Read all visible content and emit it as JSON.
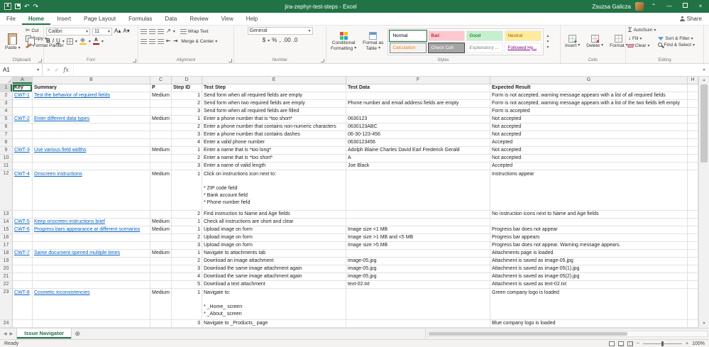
{
  "title_bar": {
    "title": "jira-zephyr-test-steps - Excel",
    "user_name": "Zsuzsa Galicza"
  },
  "ribbon_tabs": {
    "items": [
      {
        "label": "File",
        "active": false
      },
      {
        "label": "Home",
        "active": true
      },
      {
        "label": "Insert",
        "active": false
      },
      {
        "label": "Page Layout",
        "active": false
      },
      {
        "label": "Formulas",
        "active": false
      },
      {
        "label": "Data",
        "active": false
      },
      {
        "label": "Review",
        "active": false
      },
      {
        "label": "View",
        "active": false
      },
      {
        "label": "Help",
        "active": false
      }
    ],
    "share_label": "Share"
  },
  "ribbon": {
    "clipboard": {
      "group_label": "Clipboard",
      "paste_label": "Paste",
      "cut_label": "Cut",
      "copy_label": "Copy",
      "format_painter_label": "Format Painter"
    },
    "font": {
      "group_label": "Font",
      "font_name": "Calibri",
      "font_size": "11",
      "bold": "B",
      "italic": "I",
      "underline": "U"
    },
    "alignment": {
      "group_label": "Alignment",
      "wrap_text_label": "Wrap Text",
      "merge_center_label": "Merge & Center"
    },
    "number": {
      "group_label": "Number",
      "format_value": "General",
      "currency": "$",
      "percent": "%",
      "comma": ",",
      "increase_decimal": ".00",
      "decrease_decimal": ".0"
    },
    "styles": {
      "group_label": "Styles",
      "conditional_line1": "Conditional",
      "conditional_line2": "Formatting",
      "format_table_line1": "Format as",
      "format_table_line2": "Table",
      "cell_styles": [
        {
          "label": "Normal",
          "bg": "#ffffff",
          "fg": "#000000",
          "selected": true
        },
        {
          "label": "Bad",
          "bg": "#ffc7ce",
          "fg": "#9c0006"
        },
        {
          "label": "Good",
          "bg": "#c6efce",
          "fg": "#006100"
        },
        {
          "label": "Neutral",
          "bg": "#ffeb9c",
          "fg": "#9c6500"
        },
        {
          "label": "Calculation",
          "bg": "#f2f2f2",
          "fg": "#fa7d00",
          "border": "#7f7f7f"
        },
        {
          "label": "Check Cell",
          "bg": "#a5a5a5",
          "fg": "#ffffff",
          "border": "#3f3f3f"
        },
        {
          "label": "Explanatory ...",
          "bg": "#ffffff",
          "fg": "#7f7f7f",
          "italic": true
        },
        {
          "label": "Followed Hy...",
          "bg": "#ffffff",
          "fg": "#800080",
          "underline": true
        }
      ]
    },
    "cells": {
      "group_label": "Cells",
      "insert_label": "Insert",
      "delete_label": "Delete",
      "format_label": "Format"
    },
    "editing": {
      "group_label": "Editing",
      "autosum_label": "AutoSum",
      "fill_label": "Fill",
      "clear_label": "Clear",
      "sort_label": "Sort & Filter",
      "find_label": "Find & Select"
    }
  },
  "formula_bar": {
    "name_box": "A1",
    "formula": "",
    "fx_label": "fx"
  },
  "grid": {
    "col_headers": [
      "A",
      "B",
      "C",
      "D",
      "E",
      "F",
      "G",
      "H"
    ],
    "header_row": {
      "key": "Key",
      "summary": "Summary",
      "p": "P",
      "step_id": "Step ID",
      "test_step": "Test Step",
      "test_data": "Test Data",
      "expected": "Expected Result"
    },
    "rows": [
      {
        "n": 2,
        "key": "CWT-1",
        "summary": "Test the behavior of required fields",
        "p": "Medium",
        "step": "1",
        "text": "Send form when all required fields are empty",
        "data": "",
        "expected": "Form is not accepted, warning message appears with a list of all required fields"
      },
      {
        "n": 3,
        "key": "",
        "summary": "",
        "p": "",
        "step": "2",
        "text": "Send form when two required fields are empty",
        "data": "Phone number and email address fields are empty",
        "expected": "Form is not accepted, warning message appears with a list of the two fields left empty"
      },
      {
        "n": 4,
        "key": "",
        "summary": "",
        "p": "",
        "step": "3",
        "text": "Send form when all required fields are filled",
        "data": "",
        "expected": "Form is accepted"
      },
      {
        "n": 5,
        "key": "CWT-2",
        "summary": "Enter different data types",
        "p": "Medium",
        "step": "1",
        "text": "Enter a phone number that is *too short*",
        "data": "0630123",
        "expected": "Not accepted"
      },
      {
        "n": 6,
        "key": "",
        "summary": "",
        "p": "",
        "step": "2",
        "text": "Enter a phone number that contains non-numeric characters",
        "data": "0630123ABC",
        "expected": "Not accepted"
      },
      {
        "n": 7,
        "key": "",
        "summary": "",
        "p": "",
        "step": "3",
        "text": "Enter a phone number that contains dashes",
        "data": "06-30-123-456",
        "expected": "Not accepted"
      },
      {
        "n": 8,
        "key": "",
        "summary": "",
        "p": "",
        "step": "4",
        "text": "Enter a valid phone number",
        "data": "0630123456",
        "expected": "Accepted"
      },
      {
        "n": 9,
        "key": "CWT-3",
        "summary": "Use various field widths",
        "p": "Medium",
        "step": "1",
        "text": "Enter a name that is *too long*",
        "data": "Adolph Blaine Charles David Earl Frederick Gerald",
        "expected": "Not accepted"
      },
      {
        "n": 10,
        "key": "",
        "summary": "",
        "p": "",
        "step": "2",
        "text": "Enter a name that is *too short*",
        "data": "A",
        "expected": "Not accepted"
      },
      {
        "n": 11,
        "key": "",
        "summary": "",
        "p": "",
        "step": "3",
        "text": "Enter a name of valid length",
        "data": "Joe Black",
        "expected": "Accepted"
      },
      {
        "n": 12,
        "key": "CWT-4",
        "summary": "Onscreen instructions",
        "p": "Medium",
        "step": "1",
        "text": "Click on instructions icon next to:\n\n* ZIP code field\n* Bank account field\n* Phone number field",
        "data": "",
        "expected": "Instructions appear",
        "h": 57
      },
      {
        "n": 13,
        "key": "",
        "summary": "",
        "p": "",
        "step": "2",
        "text": "Find instruction to Name and Age fields",
        "data": "",
        "expected": "No instruction icons next to Name and Age fields"
      },
      {
        "n": 14,
        "key": "CWT-5",
        "summary": "Keep onscreen instructions brief",
        "p": "Medium",
        "step": "1",
        "text": "Check all instructions are short and clear",
        "data": "",
        "expected": ""
      },
      {
        "n": 15,
        "key": "CWT-6",
        "summary": "Progress bars appearance at different scenarios",
        "p": "Medium",
        "step": "1",
        "text": "Upload image on form",
        "data": "Image size <1 MB",
        "expected": "Progress bar does not appear"
      },
      {
        "n": 16,
        "key": "",
        "summary": "",
        "p": "",
        "step": "2",
        "text": "Upload image on form",
        "data": "Image size >1 MB and <5 MB",
        "expected": "Progress bar appears"
      },
      {
        "n": 17,
        "key": "",
        "summary": "",
        "p": "",
        "step": "3",
        "text": "Upload image on form",
        "data": "Image size >5 MB",
        "expected": "Progress bar does not appear. Warning message appears."
      },
      {
        "n": 18,
        "key": "CWT-7",
        "summary": "Same document opened multiple times",
        "p": "Medium",
        "step": "1",
        "text": "Navigate to attachments tab",
        "data": "",
        "expected": "Attachments page is loaded"
      },
      {
        "n": 19,
        "key": "",
        "summary": "",
        "p": "",
        "step": "2",
        "text": "Download an image attachment",
        "data": "image-05.jpg",
        "expected": "Attachment is saved as image-05.jpg"
      },
      {
        "n": 20,
        "key": "",
        "summary": "",
        "p": "",
        "step": "3",
        "text": "Download the same image attachment again",
        "data": "image-05.jpg",
        "expected": "Attachment is saved as image-05(1).jpg"
      },
      {
        "n": 21,
        "key": "",
        "summary": "",
        "p": "",
        "step": "4",
        "text": "Download the same image attachment again",
        "data": "image-05.jpg",
        "expected": "Attachment is saved as image-05(2).jpg"
      },
      {
        "n": 22,
        "key": "",
        "summary": "",
        "p": "",
        "step": "5",
        "text": "Download a text attachment",
        "data": "text-02.txt",
        "expected": "Attachment is saved as text-02.txt"
      },
      {
        "n": 23,
        "key": "CWT-8",
        "summary": "Cosmetic inconsistencies",
        "p": "Medium",
        "step": "1",
        "text": "Navigate to:\n\n* _Home_ screen\n* _About_ screen",
        "data": "",
        "expected": "Green company logo is loaded",
        "h": 44
      },
      {
        "n": 24,
        "key": "",
        "summary": "",
        "p": "",
        "step": "3",
        "text": "Navigate to _Products_ page",
        "data": "",
        "expected": "Blue company logo is loaded"
      }
    ]
  },
  "sheet_tabs": {
    "active": "Issue Navigator"
  },
  "status_bar": {
    "status": "Ready",
    "zoom": "100%"
  }
}
